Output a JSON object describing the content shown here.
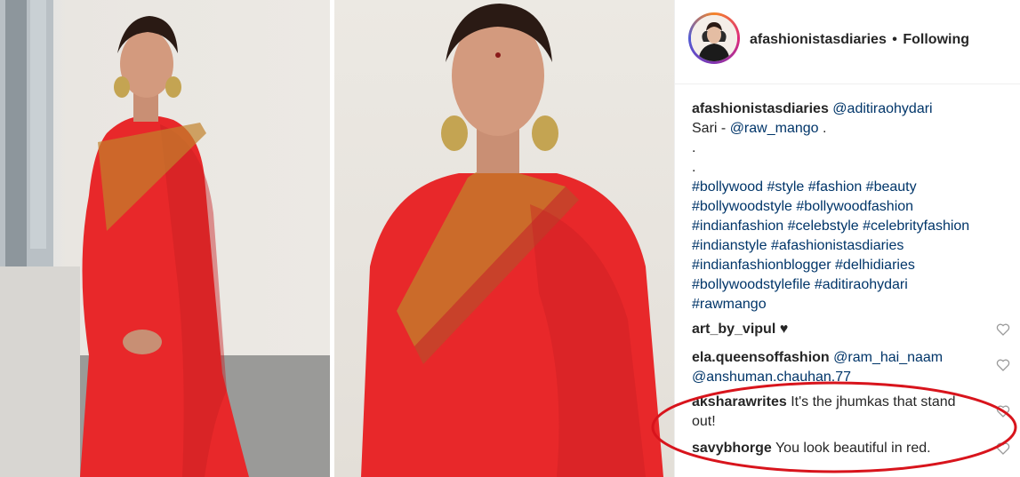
{
  "post": {
    "username": "afashionistasdiaries",
    "separator": "•",
    "follow_status": "Following"
  },
  "caption": {
    "username": "afashionistasdiaries",
    "mention": "@aditiraohydari",
    "sari_prefix": "Sari -",
    "sari_mention": "@raw_mango",
    "sari_suffix": ".",
    "dot1": ".",
    "dot2": ".",
    "hashtag_lines": [
      "#bollywood #style #fashion #beauty",
      "#bollywoodstyle #bollywoodfashion",
      "#indianfashion #celebstyle #celebrityfashion",
      "#indianstyle #afashionistasdiaries",
      "#indianfashionblogger #delhidiaries",
      "#bollywoodstylefile #aditiraohydari",
      "#rawmango"
    ]
  },
  "comments": [
    {
      "user": "art_by_vipul",
      "text": "♥"
    },
    {
      "user": "ela.queensoffashion",
      "mention1": "@ram_hai_naam",
      "mention2": "@anshuman.chauhan.77"
    },
    {
      "user": "aksharawrites",
      "text": "It's the jhumkas that stand",
      "text2": "out!"
    },
    {
      "user": "savybhorge",
      "text": "You look beautiful in red."
    }
  ],
  "icons": {
    "like": "heart-outline-icon",
    "avatar": "profile-avatar-icon"
  },
  "colors": {
    "saree_red": "#e8282a",
    "link_blue": "#003569",
    "annotation_red": "#d8141c"
  }
}
